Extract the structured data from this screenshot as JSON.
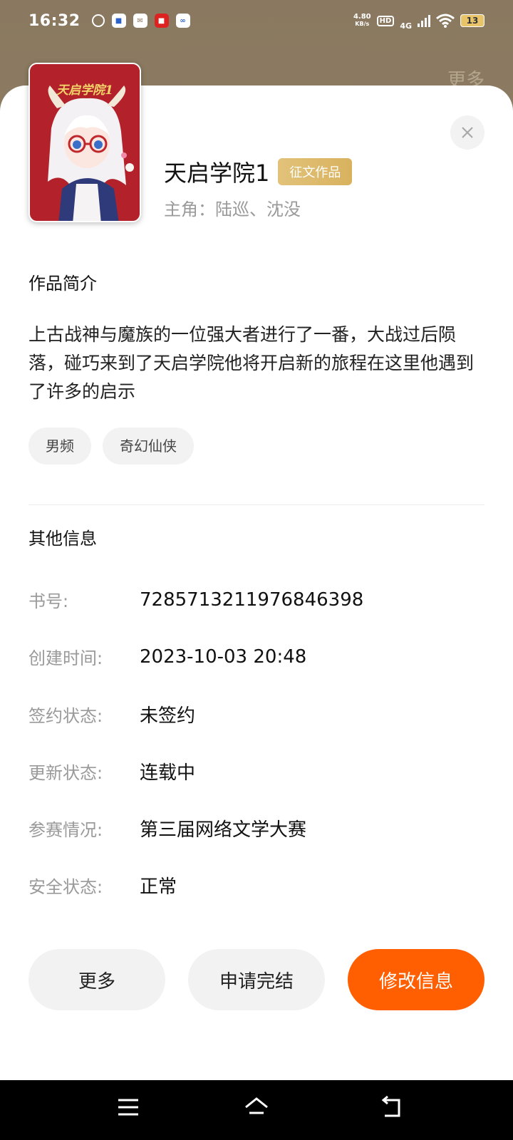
{
  "status_bar": {
    "time": "16:32",
    "net_speed_value": "4.80",
    "net_speed_unit": "KB/s",
    "hd": "HD",
    "network": "4G",
    "battery": "13"
  },
  "background": {
    "more_label": "更多"
  },
  "book": {
    "cover_title": "天启学院1",
    "title": "天启学院1",
    "badge": "征文作品",
    "protagonists": "主角：陆巡、沈没"
  },
  "synopsis": {
    "heading": "作品简介",
    "text": "上古战神与魔族的一位强大者进行了一番，大战过后陨落，碰巧来到了天启学院他将开启新的旅程在这里他遇到了许多的启示"
  },
  "tags": [
    "男频",
    "奇幻仙侠"
  ],
  "other_info": {
    "heading": "其他信息",
    "rows": [
      {
        "label": "书号:",
        "value": "7285713211976846398"
      },
      {
        "label": "创建时间:",
        "value": "2023-10-03 20:48"
      },
      {
        "label": "签约状态:",
        "value": "未签约"
      },
      {
        "label": "更新状态:",
        "value": "连载中"
      },
      {
        "label": "参赛情况:",
        "value": "第三届网络文学大赛"
      },
      {
        "label": "安全状态:",
        "value": "正常"
      }
    ]
  },
  "actions": {
    "more": "更多",
    "apply_finish": "申请完结",
    "edit_info": "修改信息"
  },
  "colors": {
    "primary": "#ff5f00",
    "badge": "#d8b25e"
  }
}
